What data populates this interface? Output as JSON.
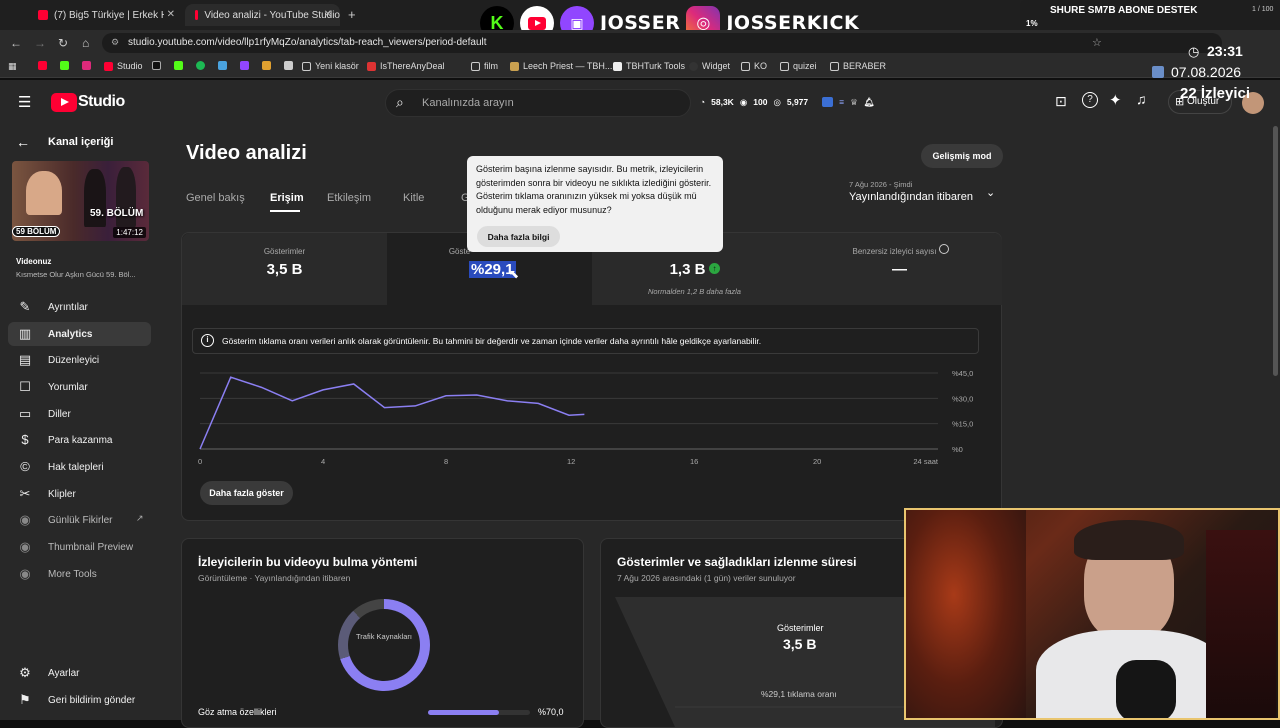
{
  "browser": {
    "tabs": [
      {
        "title": "(7) Big5 Türkiye | Erkek Hazırlık"
      },
      {
        "title": "Video analizi - YouTube Studio"
      }
    ],
    "url": "studio.youtube.com/video/llp1rfyMqZo/analytics/tab-reach_viewers/period-default",
    "bookmarks": [
      "Studio",
      "Yeni klasör",
      "IsThereAnyDeal",
      "film",
      "Leech Priest — TBH...",
      "TBHTurk Tools",
      "Widget",
      "KO",
      "quizei",
      "BERABER"
    ]
  },
  "overlay": {
    "name1": "JOSSER",
    "name2": "JOSSERKICK",
    "donation_title": "SHURE SM7B ABONE DESTEK",
    "donation_pct": "1%",
    "donation_count": "1 / 100",
    "donation_progress": 0.01,
    "clock": "23:31",
    "date": "07.08.2026",
    "viewers": "22 İzleyici"
  },
  "header": {
    "logo": "Studio",
    "search_placeholder": "Kanalınızda arayın",
    "stat1": "58,3K",
    "stat2": "100",
    "stat3": "5,977",
    "create_label": "Oluştur"
  },
  "sidebar": {
    "back_label": "Kanal içeriği",
    "thumb_badge": "59. BÖLÜM",
    "thumb_badge2": "59 BÖLÜM",
    "duration": "1:47:12",
    "video_label": "Videonuz",
    "video_title": "Kısmetse Olur Aşkın Gücü 59. Böl...",
    "items": [
      {
        "label": "Ayrıntılar"
      },
      {
        "label": "Analytics"
      },
      {
        "label": "Düzenleyici"
      },
      {
        "label": "Yorumlar"
      },
      {
        "label": "Diller"
      },
      {
        "label": "Para kazanma"
      },
      {
        "label": "Hak talepleri"
      },
      {
        "label": "Klipler"
      },
      {
        "label": "Günlük Fikirler"
      },
      {
        "label": "Thumbnail Preview"
      },
      {
        "label": "More Tools"
      }
    ],
    "settings_label": "Ayarlar",
    "feedback_label": "Geri bildirim gönder"
  },
  "main": {
    "title": "Video analizi",
    "advanced_btn": "Gelişmiş mod",
    "tabs": [
      "Genel bakış",
      "Erişim",
      "Etkileşim",
      "Kitle",
      "G"
    ],
    "date_small": "7 Ağu 2026 - Şimdi",
    "date_range": "Yayınlandığından itibaren",
    "metrics": [
      {
        "label": "Gösterimler",
        "value": "3,5 B"
      },
      {
        "label": "Göste",
        "value": "%29,1"
      },
      {
        "label": "",
        "value": "1,3 B",
        "sub": "Normalden 1,2 B daha fazla"
      },
      {
        "label": "Benzersiz izleyici sayısı",
        "value": "—"
      }
    ],
    "notice": "Gösterim tıklama oranı verileri anlık olarak görüntülenir. Bu tahmini bir değerdir ve zaman içinde veriler daha ayrıntılı hâle geldikçe ayarlanabilir.",
    "show_more": "Daha fazla göster",
    "tooltip_text": "Gösterim başına izlenme sayısıdır. Bu metrik, izleyicilerin gösterimden sonra bir videoyu ne sıklıkta izlediğini gösterir. Gösterim tıklama oranınızın yüksek mi yoksa düşük mü olduğunu merak ediyor musunuz?",
    "tooltip_btn": "Daha fazla bilgi",
    "card2_title": "İzleyicilerin bu videoyu bulma yöntemi",
    "card2_sub": "Görüntüleme · Yayınlandığından itibaren",
    "donut_label": "Trafik Kaynakları",
    "card2_row_label": "Göz atma özellikleri",
    "card2_row_value": "%70,0",
    "card2_row_fraction": 0.7,
    "card3_title": "Gösterimler ve sağladıkları izlenme süresi",
    "card3_sub": "7 Ağu 2026 arasındaki (1 gün) veriler sunuluyor",
    "funnel_label": "Gösterimler",
    "funnel_value": "3,5 B",
    "funnel_ctr": "%29,1 tıklama oranı"
  },
  "chart_data": {
    "type": "line",
    "x": [
      0,
      1,
      2,
      3,
      4,
      5,
      6,
      7,
      8,
      9,
      10,
      11,
      12,
      12.5
    ],
    "values": [
      0,
      42.5,
      36.5,
      28.5,
      35,
      38.5,
      24.5,
      25.5,
      31.5,
      32,
      28.5,
      27,
      20,
      20.5
    ],
    "xticks": [
      "0",
      "4",
      "8",
      "12",
      "16",
      "20",
      "24 saat"
    ],
    "xtick_values": [
      0,
      4,
      8,
      12,
      16,
      20,
      24
    ],
    "yticks": [
      "%0",
      "%15,0",
      "%30,0",
      "%45,0"
    ],
    "ytick_values": [
      0,
      15,
      30,
      45
    ],
    "xlim": [
      0,
      24
    ],
    "ylim": [
      0,
      45
    ],
    "grid": true,
    "color": "#8b7ff2"
  },
  "colors": {
    "accent": "#8b7ff2",
    "yt_red": "#ff0033",
    "green": "#2ba640"
  }
}
